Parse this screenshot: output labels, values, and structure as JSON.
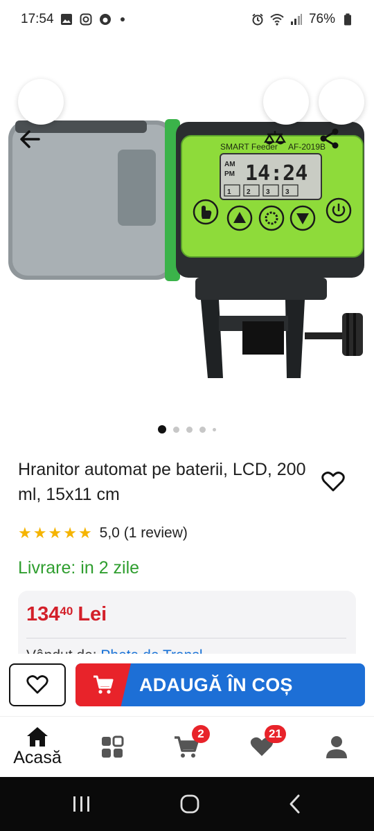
{
  "status_bar": {
    "time": "17:54",
    "battery": "76%",
    "icons": [
      "gallery-icon",
      "instagram-icon",
      "vodafone-icon",
      "alarm-icon",
      "wifi-icon",
      "signal-icon",
      "battery-icon"
    ]
  },
  "toolbar": {
    "back_icon": "arrow-left-icon",
    "compare_icon": "scale-compare-icon",
    "share_icon": "share-icon"
  },
  "product_image": {
    "brand_text": "SMART Feeder",
    "model_text": "AF-2019B",
    "lcd_time": "14:24",
    "lcd_am": "AM",
    "lcd_pm": "PM",
    "lcd_slots": [
      "1",
      "2",
      "3",
      "3"
    ],
    "carousel_count": 5,
    "carousel_active": 0
  },
  "product": {
    "title": "Hranitor automat pe baterii, LCD, 200 ml, 15x11 cm",
    "rating_stars": 5,
    "rating_text": "5,0 (1 review)",
    "delivery": "Livrare: in 2 zile",
    "price_main": "134",
    "price_cents": "40",
    "price_currency": "Lei",
    "seller_prefix": "Vândut de: ",
    "seller_name": "Pheta de Transl..."
  },
  "cart_bar": {
    "add_label": "ADAUGĂ ÎN COȘ"
  },
  "bottom_nav": {
    "items": [
      {
        "label": "Acasă",
        "icon": "home-icon"
      },
      {
        "label": "",
        "icon": "categories-icon"
      },
      {
        "label": "",
        "icon": "cart-icon",
        "badge": "2"
      },
      {
        "label": "",
        "icon": "heart-icon",
        "badge": "21"
      },
      {
        "label": "",
        "icon": "account-icon"
      }
    ]
  },
  "colors": {
    "price_red": "#d3202a",
    "delivery_green": "#2f9e2f",
    "primary_blue": "#1d6fd6",
    "cart_red": "#e8232a",
    "star_gold": "#f5b400",
    "feeder_green": "#7ed321"
  }
}
